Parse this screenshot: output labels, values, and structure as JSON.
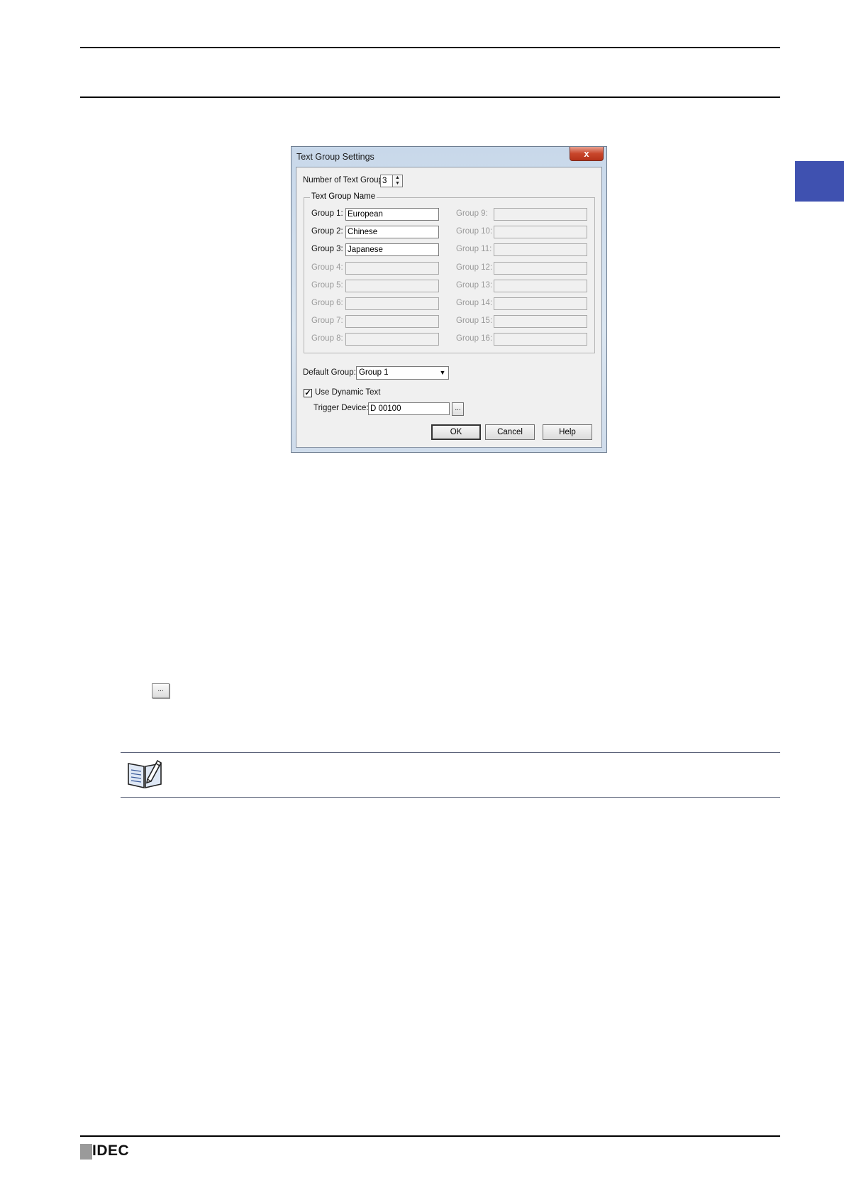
{
  "dialog": {
    "title": "Text Group Settings",
    "close_label": "x",
    "num_groups_label": "Number of Text Groups:",
    "num_groups_value": "3",
    "groupbox_title": "Text Group Name",
    "groups_left": [
      {
        "label": "Group 1:",
        "value": "European"
      },
      {
        "label": "Group 2:",
        "value": "Chinese"
      },
      {
        "label": "Group 3:",
        "value": "Japanese"
      },
      {
        "label": "Group 4:",
        "value": ""
      },
      {
        "label": "Group 5:",
        "value": ""
      },
      {
        "label": "Group 6:",
        "value": ""
      },
      {
        "label": "Group 7:",
        "value": ""
      },
      {
        "label": "Group 8:",
        "value": ""
      }
    ],
    "groups_right": [
      {
        "label": "Group 9:",
        "value": ""
      },
      {
        "label": "Group 10:",
        "value": ""
      },
      {
        "label": "Group 11:",
        "value": ""
      },
      {
        "label": "Group 12:",
        "value": ""
      },
      {
        "label": "Group 13:",
        "value": ""
      },
      {
        "label": "Group 14:",
        "value": ""
      },
      {
        "label": "Group 15:",
        "value": ""
      },
      {
        "label": "Group 16:",
        "value": ""
      }
    ],
    "default_group_label": "Default Group:",
    "default_group_value": "Group 1",
    "use_dynamic_text_label": "Use Dynamic Text",
    "use_dynamic_text_checked": true,
    "trigger_device_label": "Trigger Device:",
    "trigger_device_value": "D 00100",
    "browse_label": "...",
    "ok_label": "OK",
    "cancel_label": "Cancel",
    "help_label": "Help"
  },
  "body": {
    "browse_button_label": "..."
  },
  "footer": {
    "logo_text": "IDEC"
  },
  "colors": {
    "side_tab": "#3f51b0",
    "note_rule": "#5a6178"
  }
}
